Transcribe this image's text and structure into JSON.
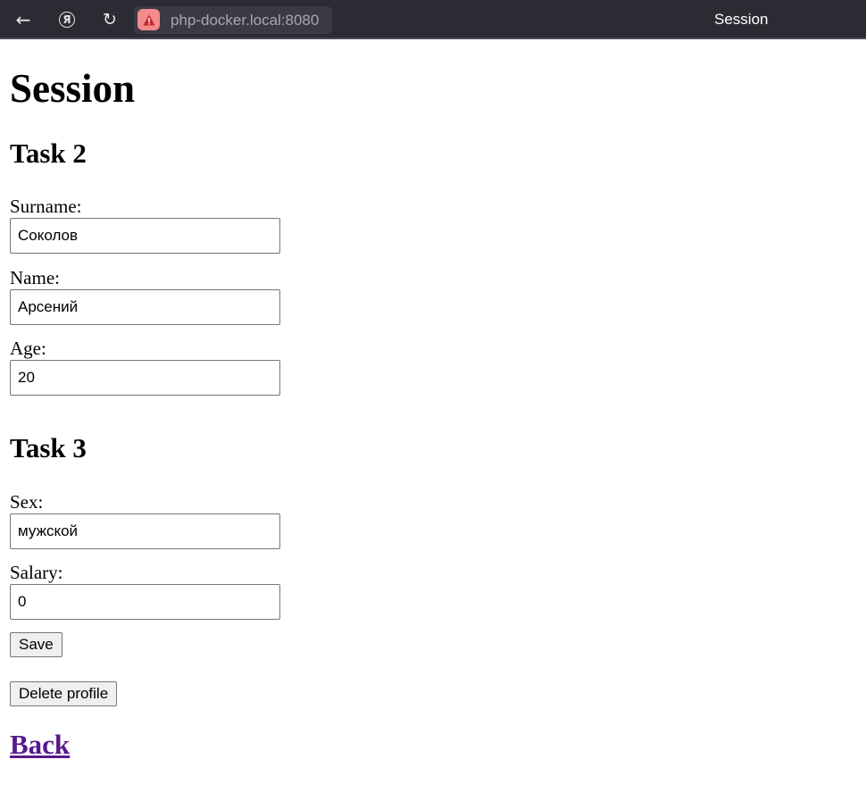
{
  "browser": {
    "url": "php-docker.local:8080",
    "tab_title": "Session",
    "icons": {
      "back": "back-arrow-icon",
      "yandex": "yandex-icon",
      "reload": "reload-icon",
      "warning": "warning-icon"
    },
    "warning_color": "#f28b8b"
  },
  "page": {
    "title": "Session",
    "task2": {
      "heading": "Task 2",
      "surname_label": "Surname:",
      "surname_value": "Соколов",
      "name_label": "Name:",
      "name_value": "Арсений",
      "age_label": "Age:",
      "age_value": "20"
    },
    "task3": {
      "heading": "Task 3",
      "sex_label": "Sex:",
      "sex_value": "мужской",
      "salary_label": "Salary:",
      "salary_value": "0"
    },
    "save_label": "Save",
    "delete_label": "Delete profile",
    "back_label": "Back",
    "link_color": "#551a8b"
  }
}
